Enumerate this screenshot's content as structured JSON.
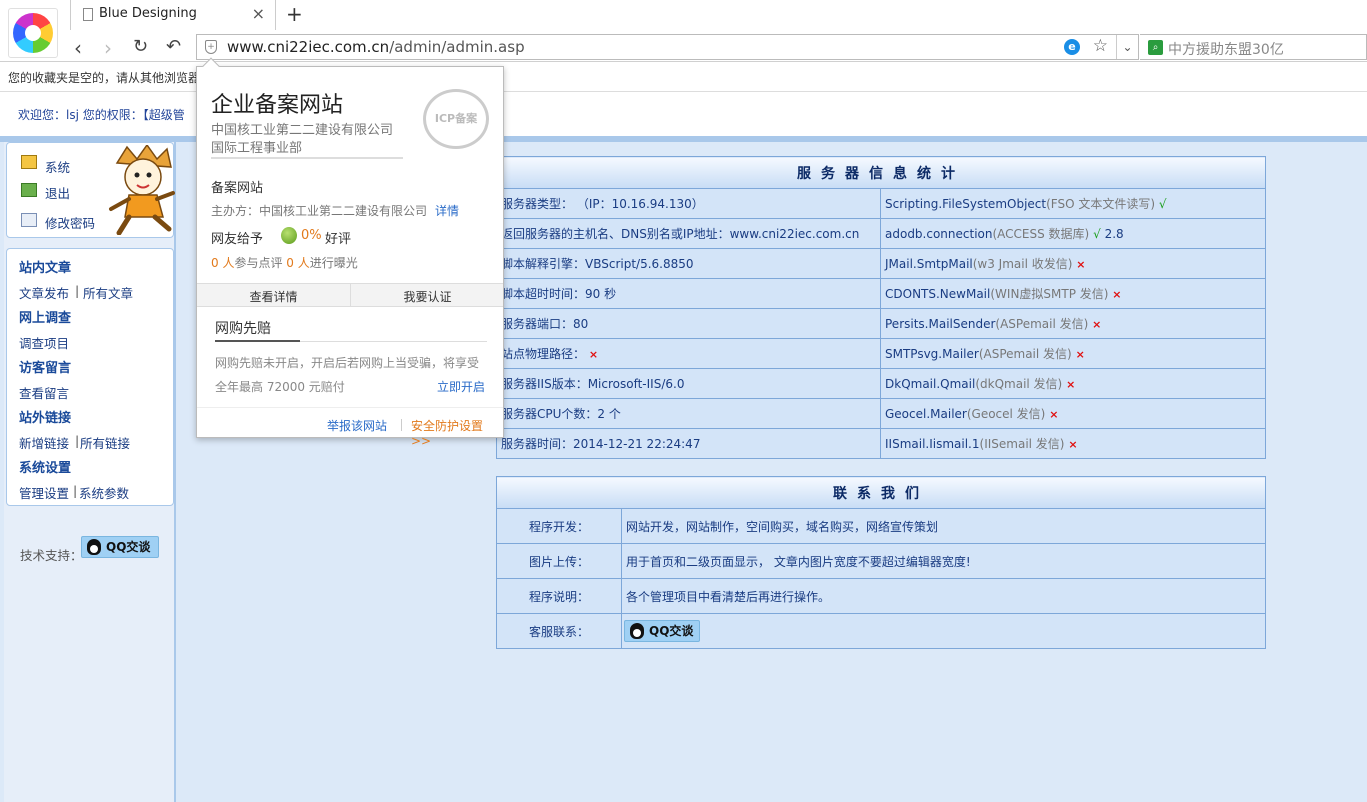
{
  "browser": {
    "tab_title": "Blue Designing",
    "new_tab": "+",
    "url_domain": "www.cni22iec.com.cn",
    "url_path": "/admin/admin.asp",
    "search_text": "中方援助东盟30亿",
    "favbar_text": "您的收藏夹是空的，请从其他浏览器"
  },
  "header": {
    "welcome": "欢迎您：lsj  您的权限：【超级管"
  },
  "sidebar": {
    "top": [
      {
        "label": "系统"
      },
      {
        "label": "退出"
      },
      {
        "label": "修改密码"
      }
    ],
    "sections": [
      {
        "head": "站内文章",
        "links": [
          "文章发布",
          "所有文章"
        ]
      },
      {
        "head": "网上调查",
        "links": [
          "调查项目"
        ]
      },
      {
        "head": "访客留言",
        "links": [
          "查看留言"
        ]
      },
      {
        "head": "站外链接",
        "links": [
          "新增链接",
          "所有链接"
        ]
      },
      {
        "head": "系统设置",
        "links": [
          "管理设置",
          "系统参数"
        ]
      }
    ],
    "tech_label": "技术支持：",
    "qq_label": "QQ交谈"
  },
  "server": {
    "title": "服务器信息统计",
    "left": [
      "服务器类型： （IP：10.16.94.130）",
      "返回服务器的主机名、DNS别名或IP地址：www.cni22iec.com.cn",
      "脚本解释引擎：VBScript/5.6.8850",
      "脚本超时时间：90 秒",
      "服务器端口：80",
      "站点物理路径：",
      "服务器IIS版本：Microsoft-IIS/6.0",
      "服务器CPU个数：2 个",
      "服务器时间：2014-12-21 22:24:47"
    ],
    "right": [
      {
        "name": "Scripting.FileSystemObject",
        "desc": "(FSO 文本文件读写)",
        "mark": "√",
        "extra": ""
      },
      {
        "name": "adodb.connection",
        "desc": "(ACCESS 数据库)",
        "mark": "√",
        "extra": "2.8"
      },
      {
        "name": "JMail.SmtpMail",
        "desc": "(w3 Jmail 收发信)",
        "mark": "×",
        "extra": ""
      },
      {
        "name": "CDONTS.NewMail",
        "desc": "(WIN虚拟SMTP 发信)",
        "mark": "×",
        "extra": ""
      },
      {
        "name": "Persits.MailSender",
        "desc": "(ASPemail 发信)",
        "mark": "×",
        "extra": ""
      },
      {
        "name": "SMTPsvg.Mailer",
        "desc": "(ASPemail 发信)",
        "mark": "×",
        "extra": ""
      },
      {
        "name": "DkQmail.Qmail",
        "desc": "(dkQmail 发信)",
        "mark": "×",
        "extra": ""
      },
      {
        "name": "Geocel.Mailer",
        "desc": "(Geocel 发信)",
        "mark": "×",
        "extra": ""
      },
      {
        "name": "IISmail.Iismail.1",
        "desc": "(IISemail 发信)",
        "mark": "×",
        "extra": ""
      }
    ],
    "path_mark": "×"
  },
  "contact": {
    "title": "联系我们",
    "rows": [
      {
        "label": "程序开发：",
        "value": "网站开发，网站制作，空间购买，域名购买，网络宣传策划"
      },
      {
        "label": "图片上传：",
        "value": "用于首页和二级页面显示， 文章内图片宽度不要超过编辑器宽度!"
      },
      {
        "label": "程序说明：",
        "value": "各个管理项目中看清楚后再进行操作。"
      },
      {
        "label": "客服联系：",
        "value": ""
      }
    ],
    "qq_label": "QQ交谈"
  },
  "popup": {
    "title": "企业备案网站",
    "sub1": "中国核工业第二二建设有限公司",
    "sub2": "国际工程事业部",
    "seal": "ICP备案",
    "h2": "备案网站",
    "org": "主办方：中国核工业第二二建设有限公司",
    "org_link": "详情",
    "rate_label": "网友给予",
    "rate_pct": "0%",
    "rate_good": "好评",
    "stat1_num": "0 人",
    "stat1_text": "参与点评",
    "stat2_num": "0 人",
    "stat2_text": "进行曝光",
    "btn_detail": "查看详情",
    "btn_cert": "我要认证",
    "buy_title": "网购先赔",
    "buy_desc": "网购先赔未开启，开启后若网购上当受骗，将享受",
    "buy_max": "全年最高 72000 元赔付",
    "buy_open": "立即开启",
    "report": "举报该网站",
    "safe": "安全防护设置>>"
  }
}
